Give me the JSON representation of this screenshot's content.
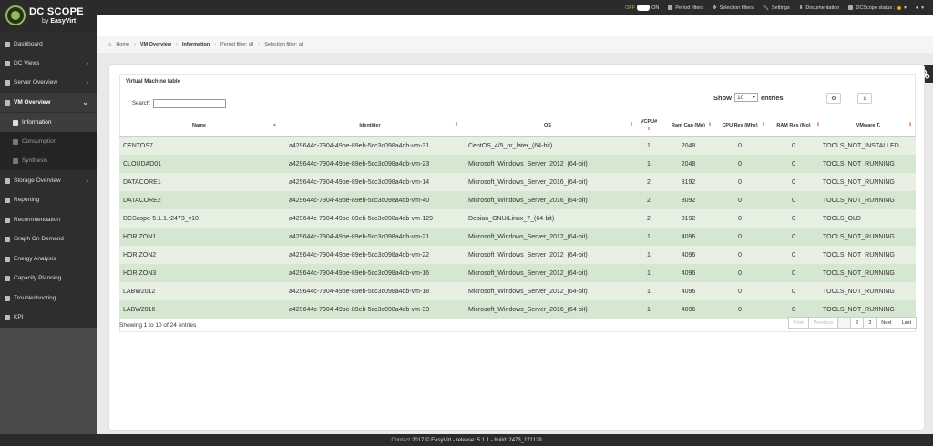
{
  "brand": {
    "title": "DC SCOPE",
    "sub_by": "by",
    "sub_name": "EasyVirt"
  },
  "topnav": {
    "toggle_off": "OFF",
    "toggle_on": "ON",
    "period_filters": "Period filters",
    "selection_filters": "Selection filters",
    "settings": "Settings",
    "documentation": "Documentation",
    "status": "DCScope status :",
    "user": "▾"
  },
  "sidebar": {
    "items": [
      {
        "label": "Dashboard",
        "icon": "dashboard-icon"
      },
      {
        "label": "DC Views",
        "icon": "globe-icon"
      },
      {
        "label": "Server Overview",
        "icon": "server-icon"
      },
      {
        "label": "VM Overview",
        "icon": "vm-icon"
      },
      {
        "label": "Storage Overview",
        "icon": "storage-icon"
      },
      {
        "label": "Reporting",
        "icon": "report-icon"
      },
      {
        "label": "Recommendation",
        "icon": "thumb-icon"
      },
      {
        "label": "Graph On Demand",
        "icon": "graph-icon"
      },
      {
        "label": "Energy Analysis",
        "icon": "energy-icon"
      },
      {
        "label": "Capacity Planning",
        "icon": "chart-icon"
      },
      {
        "label": "Troubleshooting",
        "icon": "wrench-icon"
      },
      {
        "label": "KPI",
        "icon": "kpi-icon"
      }
    ],
    "sub": [
      {
        "label": "Information"
      },
      {
        "label": "Consumption"
      },
      {
        "label": "Synthesis"
      }
    ]
  },
  "breadcrumb": {
    "home": "Home",
    "vm": "VM Overview",
    "info": "Information",
    "period": "Period filter: all",
    "selection": "Selection filter: all"
  },
  "table": {
    "title": "Virtual Machine table",
    "search_label": "Search:",
    "show_label": "Show",
    "show_value": "10",
    "entries_label": "entries",
    "columns": [
      "Name",
      "Identifier",
      "OS",
      "VCPU#",
      "Ram Cap (Mo)",
      "CPU Res (Mhz)",
      "RAM Res (Mo)",
      "VMware T."
    ],
    "rows": [
      [
        "CENTOS7",
        "a429644c-7904-49be-89eb-5cc3c098a4db-vm-31",
        "CentOS_4/5_or_later_(64-bit)",
        "1",
        "2048",
        "0",
        "0",
        "TOOLS_NOT_INSTALLED"
      ],
      [
        "CLOUDAD01",
        "a429644c-7904-49be-89eb-5cc3c098a4db-vm-23",
        "Microsoft_Windows_Server_2012_(64-bit)",
        "1",
        "2048",
        "0",
        "0",
        "TOOLS_NOT_RUNNING"
      ],
      [
        "DATACORE1",
        "a429644c-7904-49be-89eb-5cc3c098a4db-vm-14",
        "Microsoft_Windows_Server_2016_(64-bit)",
        "2",
        "8192",
        "0",
        "0",
        "TOOLS_NOT_RUNNING"
      ],
      [
        "DATACORE2",
        "a429644c-7904-49be-89eb-5cc3c098a4db-vm-40",
        "Microsoft_Windows_Server_2016_(64-bit)",
        "2",
        "8092",
        "0",
        "0",
        "TOOLS_NOT_RUNNING"
      ],
      [
        "DCScope-5.1.1.r2473_v10",
        "a429644c-7904-49be-89eb-5cc3c098a4db-vm-129",
        "Debian_GNU/Linux_7_(64-bit)",
        "2",
        "8192",
        "0",
        "0",
        "TOOLS_OLD"
      ],
      [
        "HORIZON1",
        "a429644c-7904-49be-89eb-5cc3c098a4db-vm-21",
        "Microsoft_Windows_Server_2012_(64-bit)",
        "1",
        "4096",
        "0",
        "0",
        "TOOLS_NOT_RUNNING"
      ],
      [
        "HORIZON2",
        "a429644c-7904-49be-89eb-5cc3c098a4db-vm-22",
        "Microsoft_Windows_Server_2012_(64-bit)",
        "1",
        "4096",
        "0",
        "0",
        "TOOLS_NOT_RUNNING"
      ],
      [
        "HORIZON3",
        "a429644c-7904-49be-89eb-5cc3c098a4db-vm-16",
        "Microsoft_Windows_Server_2012_(64-bit)",
        "1",
        "4096",
        "0",
        "0",
        "TOOLS_NOT_RUNNING"
      ],
      [
        "LABW2012",
        "a429644c-7904-49be-89eb-5cc3c098a4db-vm-18",
        "Microsoft_Windows_Server_2012_(64-bit)",
        "1",
        "4096",
        "0",
        "0",
        "TOOLS_NOT_RUNNING"
      ],
      [
        "LABW2016",
        "a429644c-7904-49be-89eb-5cc3c098a4db-vm-33",
        "Microsoft_Windows_Server_2016_(64-bit)",
        "1",
        "4096",
        "0",
        "0",
        "TOOLS_NOT_RUNNING"
      ]
    ],
    "info": "Showing 1 to 10 of 24 entries",
    "pager": {
      "first": "First",
      "previous": "Previous",
      "p1": "1",
      "p2": "2",
      "p3": "3",
      "next": "Next",
      "last": "Last"
    }
  },
  "footer": {
    "contact": "Contact",
    "copy": "2017 © EasyVirt - release: 5.1.1 - build: 2473_171129"
  }
}
